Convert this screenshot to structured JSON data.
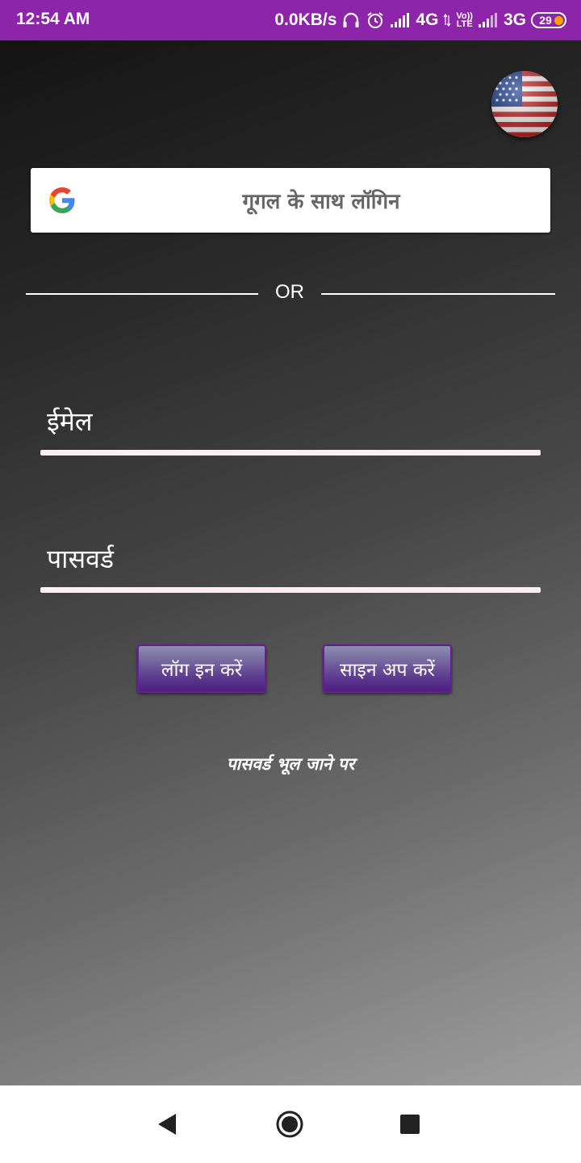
{
  "status_bar": {
    "time": "12:54 AM",
    "network_speed": "0.0KB/s",
    "sim1_type": "4G",
    "volte_top": "Vo))",
    "volte_bottom": "LTE",
    "sim2_type": "3G",
    "battery_level": "29",
    "icons": [
      "headset-icon",
      "alarm-icon",
      "signal-icon",
      "data-arrows-icon",
      "signal-icon",
      "battery-icon"
    ]
  },
  "language": {
    "icon": "us-flag-icon"
  },
  "google_login": {
    "label": "गूगल के साथ लॉगिन",
    "icon": "google-logo-icon"
  },
  "divider": {
    "text": "OR"
  },
  "email": {
    "placeholder": "ईमेल",
    "value": ""
  },
  "password": {
    "placeholder": "पासवर्ड",
    "value": ""
  },
  "buttons": {
    "login": "लॉग इन करें",
    "signup": "साइन अप करें"
  },
  "forgot_password": "पासवर्ड भूल जाने पर",
  "nav": {
    "icons": [
      "back-icon",
      "home-icon",
      "recents-icon"
    ]
  },
  "colors": {
    "status_bar": "#8e24aa",
    "button_border": "#6a1b9a",
    "field_underline": "#fceff2"
  }
}
